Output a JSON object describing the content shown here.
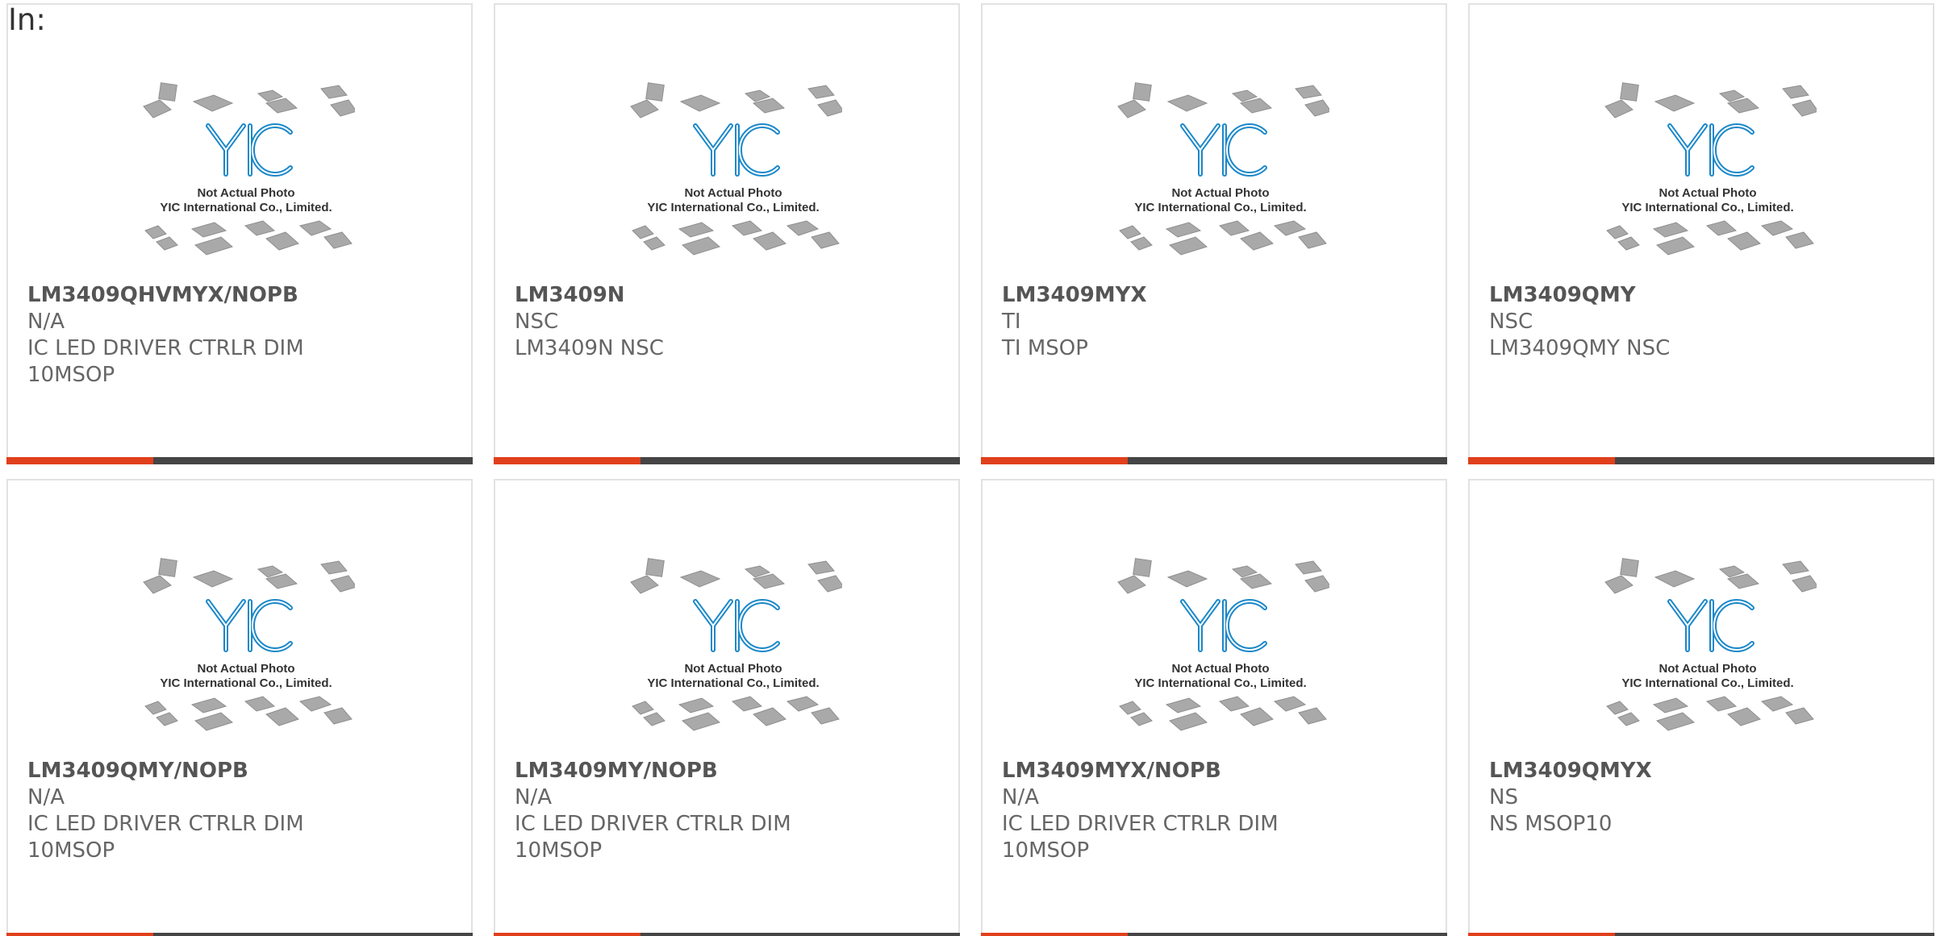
{
  "header": {
    "label": "In:"
  },
  "photo": {
    "line1": "Not Actual Photo",
    "line2": "YIC International Co., Limited.",
    "logo": "YIC"
  },
  "colors": {
    "accent": "#e0401c",
    "bar": "#454545",
    "logo_blue": "#1b88c9"
  },
  "products": [
    {
      "part": "LM3409QHVMYX/NOPB",
      "mfr": "N/A",
      "desc": "IC LED DRIVER CTRLR DIM 10MSOP"
    },
    {
      "part": "LM3409N",
      "mfr": "NSC",
      "desc": "LM3409N NSC"
    },
    {
      "part": "LM3409MYX",
      "mfr": "TI",
      "desc": "TI MSOP"
    },
    {
      "part": "LM3409QMY",
      "mfr": "NSC",
      "desc": "LM3409QMY NSC"
    },
    {
      "part": "LM3409QMY/NOPB",
      "mfr": "N/A",
      "desc": "IC LED DRIVER CTRLR DIM 10MSOP"
    },
    {
      "part": "LM3409MY/NOPB",
      "mfr": "N/A",
      "desc": "IC LED DRIVER CTRLR DIM 10MSOP"
    },
    {
      "part": "LM3409MYX/NOPB",
      "mfr": "N/A",
      "desc": "IC LED DRIVER CTRLR DIM 10MSOP"
    },
    {
      "part": "LM3409QMYX",
      "mfr": "NS",
      "desc": "NS MSOP10"
    }
  ]
}
